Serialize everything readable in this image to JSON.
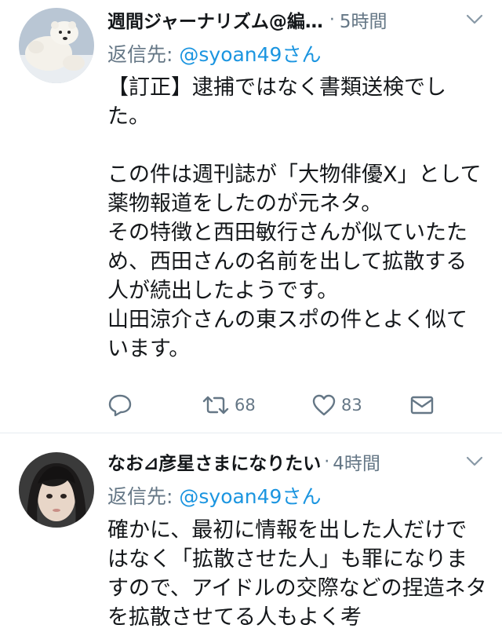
{
  "tweets": [
    {
      "name": "週間ジャーナリズム@編…",
      "separator": "·",
      "time": "5時間",
      "reply_prefix": "返信先: ",
      "reply_handle": "@syoan49さん",
      "text": "【訂正】逮捕ではなく書類送検でした。\n\nこの件は週刊誌が「大物俳優X」として薬物報道をしたのが元ネタ。\nその特徴と西田敏行さんが似ていたため、西田さんの名前を出して拡散する人が続出したようです。\n山田涼介さんの東スポの件とよく似ています。",
      "retweets": "68",
      "likes": "83",
      "avatar": "polar-bear-avatar"
    },
    {
      "name": "なお⊿彦星さまになりたい",
      "separator": "·",
      "time": "4時間",
      "reply_prefix": "返信先: ",
      "reply_handle": "@syoan49さん",
      "text": "確かに、最初に情報を出した人だけではなく「拡散させた人」も罪になりますので、アイドルの交際などの捏造ネタを拡散させてる人もよく考",
      "avatar": "person-avatar"
    }
  ],
  "icons": {
    "reply": "reply-icon",
    "retweet": "retweet-icon",
    "like": "heart-icon",
    "dm": "envelope-icon",
    "menu": "chevron-down-icon"
  },
  "colors": {
    "text": "#14171a",
    "secondary": "#657786",
    "link": "#1b95e0",
    "divider": "#e6ecf0"
  }
}
